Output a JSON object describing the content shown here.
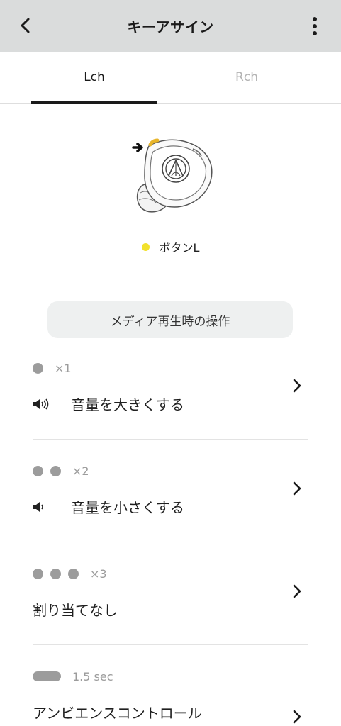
{
  "header": {
    "title": "キーアサイン",
    "back_icon": "chevron-left-icon",
    "more_icon": "more-vert-icon"
  },
  "tabs": [
    {
      "label": "Lch",
      "selected": true
    },
    {
      "label": "Rch",
      "selected": false
    }
  ],
  "device": {
    "button_indicator_color": "#f2e12c",
    "button_label": "ボタンL"
  },
  "section": {
    "title": "メディア再生時の操作"
  },
  "assignments": [
    {
      "count": "×1",
      "action": "音量を大きくする",
      "icon": "volume-up-icon"
    },
    {
      "count": "×2",
      "action": "音量を小さくする",
      "icon": "volume-down-icon"
    },
    {
      "count": "×3",
      "action": "割り当てなし"
    },
    {
      "count": "1.5 sec",
      "action": "アンビエンスコントロール"
    }
  ],
  "colors": {
    "appbar": "#dadcdc",
    "accent_yellow": "#f2e12c",
    "dot_gray": "#9c9c9c",
    "tab_inactive": "#b3b3b3"
  }
}
